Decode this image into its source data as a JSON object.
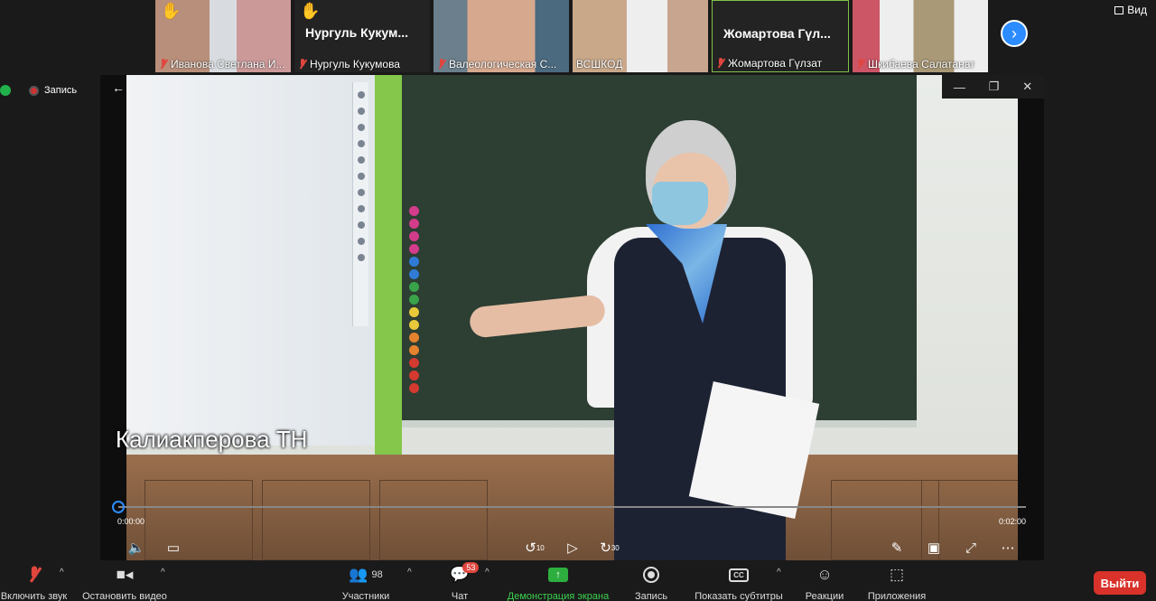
{
  "gallery": {
    "tiles": [
      {
        "name": "Иванова Светлана И..."
      },
      {
        "name": "Нургуль Кукумова",
        "display_name": "Нургуль  Кукум..."
      },
      {
        "name": "Валеологическая С..."
      },
      {
        "name": "ВСШКОД"
      },
      {
        "name": "Жомартова Гүлзат",
        "display_name": "Жомартова  Гүл..."
      },
      {
        "name": "Шкибаева Салатанат"
      }
    ],
    "view_label": "Вид",
    "next_icon": "chevron-right-icon"
  },
  "recording_label": "Запись",
  "player": {
    "speaker_name": "Калиакперова ТН",
    "time_start": "0:00:00",
    "time_end": "0:02:00",
    "progress": 0.0,
    "rewind_label": "10",
    "forward_label": "30"
  },
  "toolbar": {
    "mute_label": "Включить звук",
    "video_label": "Остановить видео",
    "participants_label": "Участники",
    "participants_count": "98",
    "chat_label": "Чат",
    "chat_badge": "53",
    "share_label": "Демонстрация экрана",
    "record_label": "Запись",
    "captions_label": "Показать субтитры",
    "captions_icon_text": "CC",
    "reactions_label": "Реакции",
    "apps_label": "Приложения",
    "leave_label": "Выйти"
  },
  "colors": {
    "accent": "#2d8cff",
    "leave": "#d8322a",
    "share": "#2dae3f",
    "muted": "#e0463e"
  }
}
